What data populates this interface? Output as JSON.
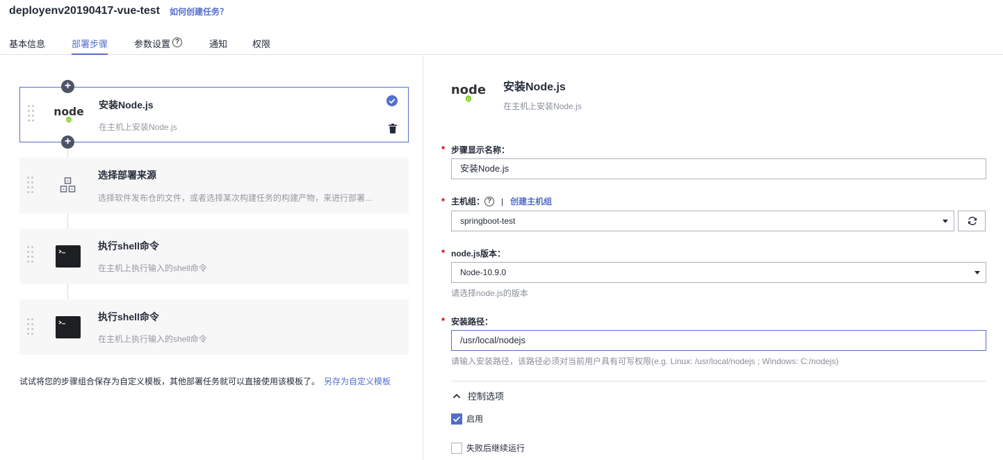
{
  "header": {
    "task_title": "deployenv20190417-vue-test",
    "help_link": "如何创建任务？"
  },
  "tabs": [
    {
      "label": "基本信息",
      "active": false
    },
    {
      "label": "部署步骤",
      "active": true
    },
    {
      "label": "参数设置",
      "active": false,
      "has_help_icon": true
    },
    {
      "label": "通知",
      "active": false
    },
    {
      "label": "权限",
      "active": false
    }
  ],
  "steps": [
    {
      "title": "安装Node.js",
      "desc": "在主机上安装Node.js",
      "icon": "nodejs-logo",
      "selected": true
    },
    {
      "title": "选择部署来源",
      "desc": "选择软件发布仓的文件，或者选择某次构建任务的构建产物，来进行部署...",
      "icon": "package-icon",
      "selected": false
    },
    {
      "title": "执行shell命令",
      "desc": "在主机上执行输入的shell命令",
      "icon": "terminal-icon",
      "selected": false
    },
    {
      "title": "执行shell命令",
      "desc": "在主机上执行输入的shell命令",
      "icon": "terminal-icon",
      "selected": false
    }
  ],
  "template_tip": {
    "text": "试试将您的步骤组合保存为自定义模板，其他部署任务就可以直接使用该模板了。",
    "link": "另存为自定义模板"
  },
  "detail": {
    "title": "安装Node.js",
    "desc": "在主机上安装Node.js",
    "nodejs_logo_text": "node",
    "fields": {
      "display_name": {
        "label": "步骤显示名称：",
        "value": "安装Node.js"
      },
      "host_group": {
        "label": "主机组：",
        "separator": "|",
        "create_link": "创建主机组",
        "value": "springboot-test"
      },
      "node_version": {
        "label": "node.js版本：",
        "value": "Node-10.9.0",
        "hint": "请选择node.js的版本"
      },
      "install_path": {
        "label": "安装路径：",
        "value": "/usr/local/nodejs",
        "hint": "请输入安装路径，该路径必须对当前用户具有可写权限(e.g. Linux: /usr/local/nodejs ; Windows: C:/nodejs)"
      }
    },
    "control_options": {
      "label": "控制选项",
      "expanded": true,
      "enable": {
        "label": "启用",
        "checked": true
      },
      "continue_on_fail": {
        "label": "失败后继续运行",
        "checked": false
      }
    }
  },
  "colors": {
    "accent": "#526ecc",
    "required": "#c7000b",
    "node_green": "#83cd29"
  }
}
